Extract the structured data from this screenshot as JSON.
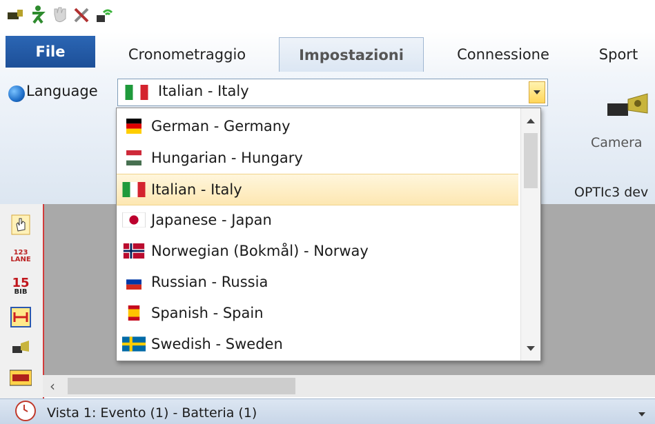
{
  "tabs": {
    "file": "File",
    "cronometraggio": "Cronometraggio",
    "impostazioni": "Impostazioni",
    "connessione": "Connessione",
    "sport": "Sport"
  },
  "language": {
    "label": "Language",
    "selected": "Italian - Italy",
    "options": [
      {
        "label": "German - Germany",
        "flag": "de"
      },
      {
        "label": "Hungarian - Hungary",
        "flag": "hu"
      },
      {
        "label": "Italian - Italy",
        "flag": "it"
      },
      {
        "label": "Japanese - Japan",
        "flag": "jp"
      },
      {
        "label": "Norwegian (Bokmål) - Norway",
        "flag": "no"
      },
      {
        "label": "Russian - Russia",
        "flag": "ru"
      },
      {
        "label": "Spanish - Spain",
        "flag": "es"
      },
      {
        "label": "Swedish - Sweden",
        "flag": "se"
      }
    ]
  },
  "ribbon": {
    "camera_label": "Camera",
    "optic_label": "OPTIc3 dev"
  },
  "sidebar": {
    "lane_text": "123 LANE",
    "bib_number": "15",
    "bib_text": "BIB"
  },
  "status": {
    "text": "Vista 1: Evento (1) - Batteria (1)"
  },
  "colors": {
    "file_tab": "#1d4f98",
    "selected_row": "#fde7b2",
    "main_area": "#a9a9a9"
  }
}
